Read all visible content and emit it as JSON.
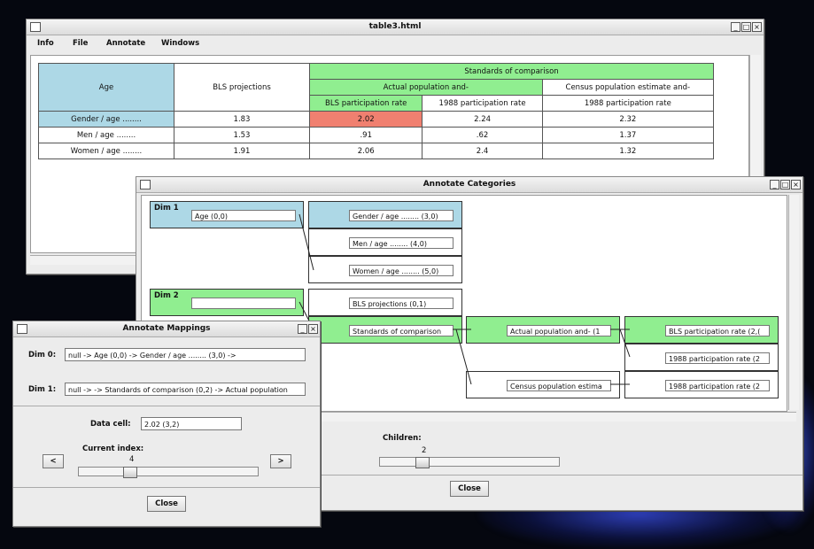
{
  "main_window": {
    "title": "table3.html",
    "menu": [
      "Info",
      "File",
      "Annotate",
      "Windows"
    ],
    "table": {
      "age_header": "Age",
      "bls_header": "BLS projections",
      "standards_header": "Standards of comparison",
      "actual_header": "Actual population and-",
      "census_header": "Census population estimate and-",
      "sub_headers": [
        "BLS participation rate",
        "1988 participation rate",
        "1988 participation rate"
      ],
      "rows": [
        {
          "label": "Gender / age ........",
          "values": [
            "1.83",
            "2.02",
            "2.24",
            "2.32"
          ]
        },
        {
          "label": "Men / age ........",
          "values": [
            "1.53",
            ".91",
            ".62",
            "1.37"
          ]
        },
        {
          "label": "Women / age ........",
          "values": [
            "1.91",
            "2.06",
            "2.4",
            "1.32"
          ]
        }
      ]
    }
  },
  "categories_window": {
    "title": "Annotate Categories",
    "dim1_label": "Dim 1",
    "dim1_field": "Age (0,0)",
    "dim1_children": [
      "Gender / age ........ (3,0)",
      "Men / age ........ (4,0)",
      "Women / age ........ (5,0)"
    ],
    "dim2_label": "Dim 2",
    "dim2_field": "",
    "dim2_children": [
      "BLS projections (0,1)",
      "Standards of comparison"
    ],
    "level3": [
      "Actual population and- (1",
      "Census population estima"
    ],
    "level4": [
      "BLS participation rate (2,(",
      "1988 participation rate (2",
      "1988 participation rate (2"
    ],
    "children_label": "Children:",
    "children_value": "2",
    "children_slider_fraction": 0.25,
    "close": "Close"
  },
  "mappings_window": {
    "title": "Annotate Mappings",
    "dim0_label": "Dim 0:",
    "dim0_value": "null -> Age (0,0) -> Gender / age ........ (3,0) ->",
    "dim1_label": "Dim 1:",
    "dim1_value": "null -> -> Standards of comparison (0,2) -> Actual population",
    "data_cell_label": "Data cell:",
    "data_cell_value": "2.02 (3,2)",
    "current_index_label": "Current index:",
    "current_index_value": "4",
    "index_slider_fraction": 0.3,
    "prev": "<",
    "next": ">",
    "close": "Close"
  }
}
